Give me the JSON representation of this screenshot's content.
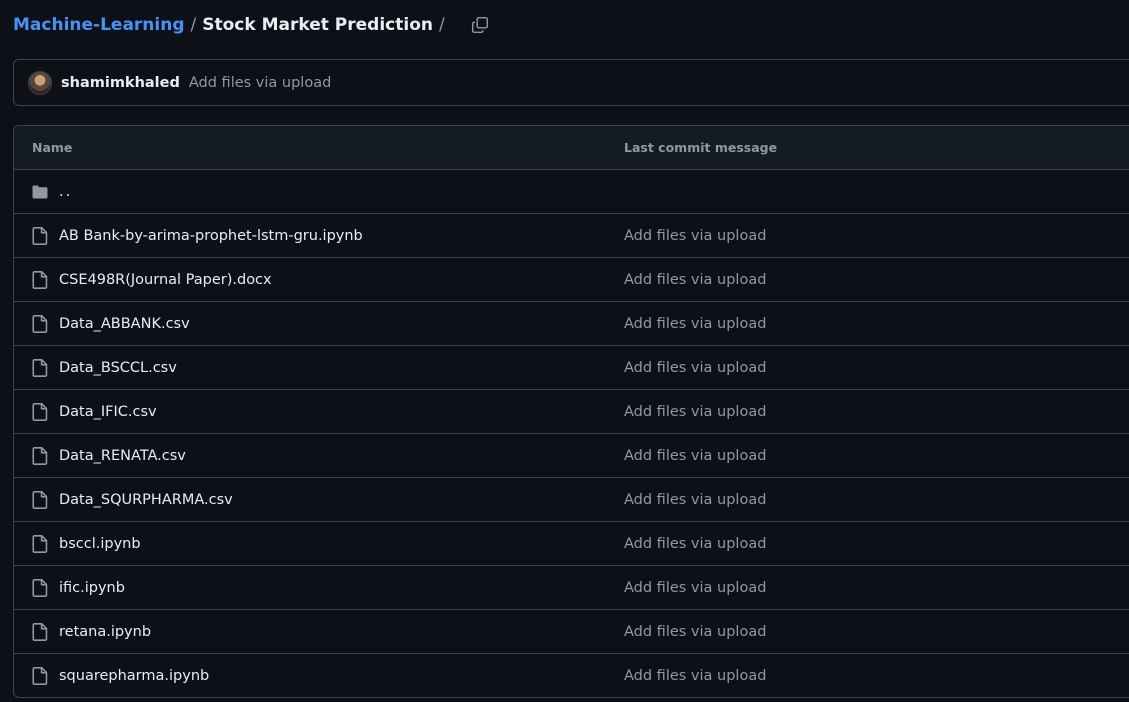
{
  "breadcrumb": {
    "repo": "Machine-Learning",
    "separator": "/",
    "folder": "Stock Market Prediction",
    "trailing_separator": "/",
    "copy_icon": "copy-icon"
  },
  "latest_commit": {
    "author": "shamimkhaled",
    "message": "Add files via upload"
  },
  "table": {
    "headers": {
      "name": "Name",
      "last_commit": "Last commit message"
    },
    "parent": "..",
    "files": [
      {
        "name": "AB Bank-by-arima-prophet-lstm-gru.ipynb",
        "message": "Add files via upload"
      },
      {
        "name": "CSE498R(Journal Paper).docx",
        "message": "Add files via upload"
      },
      {
        "name": "Data_ABBANK.csv",
        "message": "Add files via upload"
      },
      {
        "name": "Data_BSCCL.csv",
        "message": "Add files via upload"
      },
      {
        "name": "Data_IFIC.csv",
        "message": "Add files via upload"
      },
      {
        "name": "Data_RENATA.csv",
        "message": "Add files via upload"
      },
      {
        "name": "Data_SQURPHARMA.csv",
        "message": "Add files via upload"
      },
      {
        "name": "bsccl.ipynb",
        "message": "Add files via upload"
      },
      {
        "name": "ific.ipynb",
        "message": "Add files via upload"
      },
      {
        "name": "retana.ipynb",
        "message": "Add files via upload"
      },
      {
        "name": "squarepharma.ipynb",
        "message": "Add files via upload"
      }
    ]
  },
  "colors": {
    "background": "#0d1117",
    "link": "#4493f8",
    "border": "#3d444d",
    "muted_text": "#9198a1",
    "text": "#e6edf3"
  }
}
